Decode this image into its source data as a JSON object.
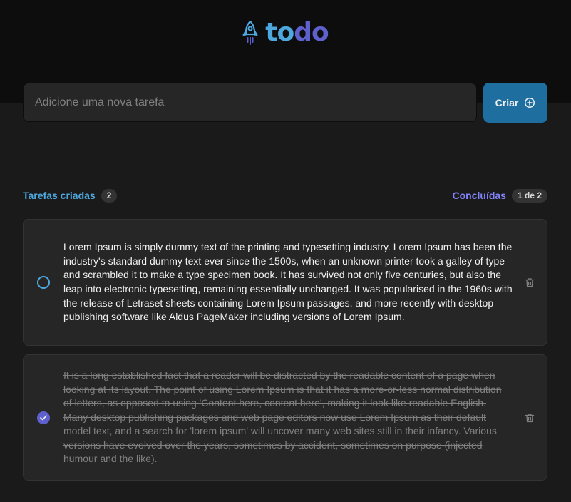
{
  "app": {
    "logo_part1": "to",
    "logo_part2": "do",
    "logo_icon": "rocket-icon"
  },
  "new_task": {
    "placeholder": "Adicione uma nova tarefa",
    "value": "",
    "create_label": "Criar",
    "create_icon": "plus-circle-icon"
  },
  "summary": {
    "created_label": "Tarefas criadas",
    "created_count": "2",
    "done_label": "Concluídas",
    "done_count": "1 de 2"
  },
  "tasks": [
    {
      "text": "Lorem Ipsum is simply dummy text of the printing and typesetting industry. Lorem Ipsum has been the industry's standard dummy text ever since the 1500s, when an unknown printer took a galley of type and scrambled it to make a type specimen book. It has survived not only five centuries, but also the leap into electronic typesetting, remaining essentially unchanged. It was popularised in the 1960s with the release of Letraset sheets containing Lorem Ipsum passages, and more recently with desktop publishing software like Aldus PageMaker including versions of Lorem Ipsum.",
      "completed": false
    },
    {
      "text": "It is a long established fact that a reader will be distracted by the readable content of a page when looking at its layout. The point of using Lorem Ipsum is that it has a more-or-less normal distribution of letters, as opposed to using 'Content here, content here', making it look like readable English. Many desktop publishing packages and web page editors now use Lorem Ipsum as their default model text, and a search for 'lorem ipsum' will uncover many web sites still in their infancy. Various versions have evolved over the years, sometimes by accident, sometimes on purpose (injected humour and the like).",
      "completed": true
    }
  ],
  "colors": {
    "blue": "#4ea8de",
    "blue_dark": "#1e6f9f",
    "purple": "#5e60ce",
    "purple_light": "#8284fa",
    "background": "#1a1a1a",
    "header": "#0d0d0d",
    "card": "#262626"
  }
}
